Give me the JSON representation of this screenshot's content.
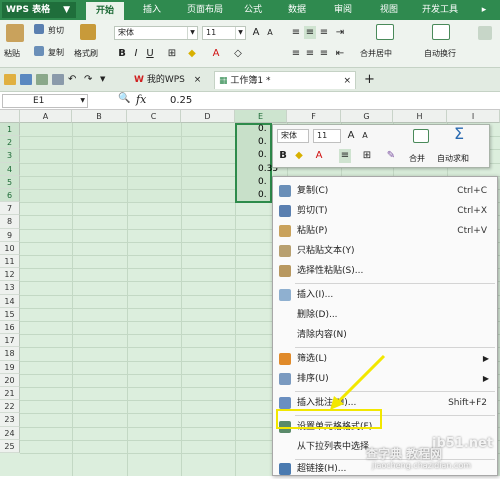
{
  "app": {
    "name": "WPS 表格"
  },
  "ribbon_tabs": [
    "开始",
    "插入",
    "页面布局",
    "公式",
    "数据",
    "审阅",
    "视图",
    "开发工具"
  ],
  "ribbon": {
    "paste": "粘贴",
    "cut": "剪切",
    "copy": "复制",
    "format_painter": "格式刷",
    "font_name": "宋体",
    "font_size": "11",
    "merge_center": "合并居中",
    "wrap_text": "自动换行"
  },
  "tabs": {
    "my_wps": "我的WPS",
    "workbook": "工作簿1 *"
  },
  "formula_bar": {
    "cell_ref": "E1",
    "fx": "fx",
    "value": "0.25"
  },
  "columns": [
    "A",
    "B",
    "C",
    "D",
    "E",
    "F",
    "G",
    "H",
    "I"
  ],
  "rows": [
    "1",
    "2",
    "3",
    "4",
    "5",
    "6",
    "7",
    "8",
    "9",
    "10",
    "11",
    "12",
    "13",
    "14",
    "15",
    "16",
    "17",
    "18",
    "19",
    "20",
    "21",
    "22",
    "23",
    "24",
    "25"
  ],
  "cells_e": [
    "0.",
    "0.",
    "0.",
    "0.35",
    "0.",
    "0."
  ],
  "mini_toolbar": {
    "font": "宋体",
    "size": "11",
    "merge": "合并",
    "autosum": "自动求和"
  },
  "context_menu": [
    {
      "label": "复制(C)",
      "shortcut": "Ctrl+C",
      "icon": "copy-icon"
    },
    {
      "label": "剪切(T)",
      "shortcut": "Ctrl+X",
      "icon": "scissors-icon"
    },
    {
      "label": "粘贴(P)",
      "shortcut": "Ctrl+V",
      "icon": "paste-icon"
    },
    {
      "label": "只粘贴文本(Y)",
      "shortcut": "",
      "icon": "paste-text-icon"
    },
    {
      "label": "选择性粘贴(S)...",
      "shortcut": "",
      "icon": "paste-special-icon"
    },
    {
      "label": "插入(I)...",
      "shortcut": "",
      "icon": "insert-icon"
    },
    {
      "label": "删除(D)...",
      "shortcut": "",
      "icon": ""
    },
    {
      "label": "清除内容(N)",
      "shortcut": "",
      "icon": ""
    },
    {
      "label": "筛选(L)",
      "shortcut": "",
      "icon": "filter-icon"
    },
    {
      "label": "排序(U)",
      "shortcut": "",
      "icon": "sort-icon"
    },
    {
      "label": "插入批注(M)...",
      "shortcut": "Shift+F2",
      "icon": "comment-icon"
    },
    {
      "label": "设置单元格格式(F)...",
      "shortcut": "",
      "icon": "format-cells-icon"
    },
    {
      "label": "从下拉列表中选择",
      "shortcut": "",
      "icon": ""
    },
    {
      "label": "超链接(H)...",
      "shortcut": "",
      "icon": "hyperlink-icon"
    }
  ],
  "watermark": {
    "site": "jb51.net",
    "cn": "查字典 教程网",
    "url": "jiaocheng.chazidian.com"
  },
  "colors": {
    "accent": "#2f8a4f",
    "highlight": "#f2e700"
  }
}
